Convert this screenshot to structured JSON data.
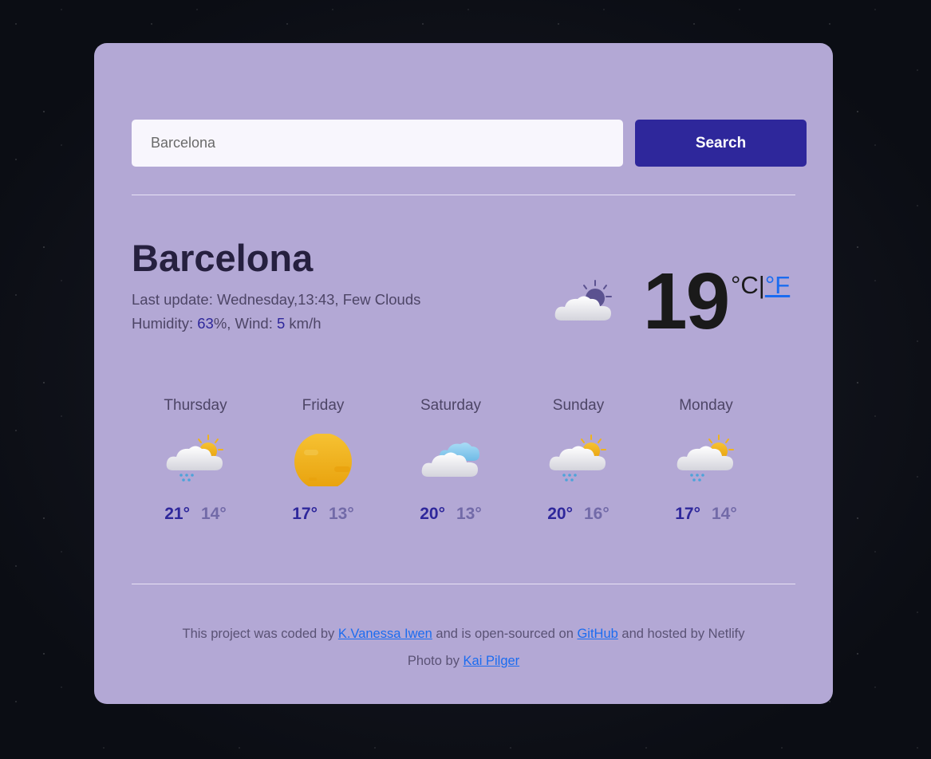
{
  "search": {
    "placeholder": "Barcelona",
    "button_label": "Search"
  },
  "current": {
    "city": "Barcelona",
    "last_update_prefix": "Last update: ",
    "last_update": "Wednesday,13:43",
    "description": "Few Clouds",
    "humidity_label": "Humidity: ",
    "humidity": "63",
    "humidity_unit": "%",
    "wind_label": ", Wind: ",
    "wind": "5",
    "wind_unit": " km/h",
    "temperature": "19",
    "unit_celsius": "°C",
    "unit_separator": "|",
    "unit_fahrenheit": "°F",
    "icon": "few-clouds-icon"
  },
  "forecast": [
    {
      "day": "Thursday",
      "max": "21°",
      "min": "14°",
      "icon": "rain-sun-icon"
    },
    {
      "day": "Friday",
      "max": "17°",
      "min": "13°",
      "icon": "sun-icon"
    },
    {
      "day": "Saturday",
      "max": "20°",
      "min": "13°",
      "icon": "cloudy-icon"
    },
    {
      "day": "Sunday",
      "max": "20°",
      "min": "16°",
      "icon": "rain-sun-icon"
    },
    {
      "day": "Monday",
      "max": "17°",
      "min": "14°",
      "icon": "rain-sun-icon"
    }
  ],
  "footer": {
    "text1": "This project was coded by ",
    "author_link": "K.Vanessa Iwen",
    "text2": " and is open-sourced on ",
    "github_link": "GitHub",
    "text3": " and hosted by Netlify",
    "photo_prefix": "Photo by ",
    "photo_link": "Kai Pilger"
  },
  "colors": {
    "card_background": "#b3a8d5",
    "button": "#2e279b",
    "link": "#1b6cf0"
  }
}
